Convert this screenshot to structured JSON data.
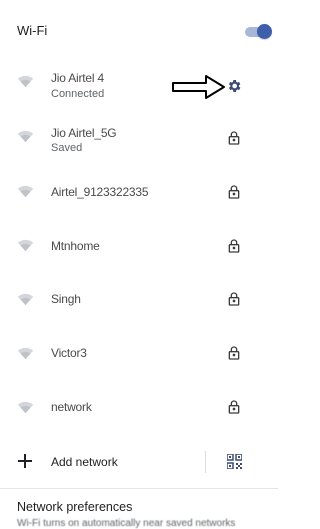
{
  "wifi": {
    "title": "Wi-Fi",
    "enabled": true,
    "accent_color": "#3f5faa"
  },
  "networks": [
    {
      "name": "Jio Airtel 4",
      "status": "Connected",
      "signal_icon": "wifi-signal-icon",
      "action_icon": "gear-icon"
    },
    {
      "name": "Jio Airtel_5G",
      "status": "Saved",
      "signal_icon": "wifi-signal-icon",
      "action_icon": "lock-icon"
    },
    {
      "name": "Airtel_9123322335",
      "status": "",
      "signal_icon": "wifi-signal-icon",
      "action_icon": "lock-icon"
    },
    {
      "name": "Mtnhome",
      "status": "",
      "signal_icon": "wifi-signal-icon",
      "action_icon": "lock-icon"
    },
    {
      "name": "Singh",
      "status": "",
      "signal_icon": "wifi-signal-icon",
      "action_icon": "lock-icon"
    },
    {
      "name": "Victor3",
      "status": "",
      "signal_icon": "wifi-signal-icon",
      "action_icon": "lock-icon"
    },
    {
      "name": "network",
      "status": "",
      "signal_icon": "wifi-signal-icon",
      "action_icon": "lock-icon"
    }
  ],
  "add_network": {
    "label": "Add network",
    "icon": "plus-icon",
    "qr_icon": "qr-code-scanner-icon"
  },
  "preferences": {
    "title": "Network preferences",
    "subtitle": "Wi-Fi turns on automatically near saved networks"
  },
  "annotation": {
    "icon": "arrow-right-icon"
  }
}
